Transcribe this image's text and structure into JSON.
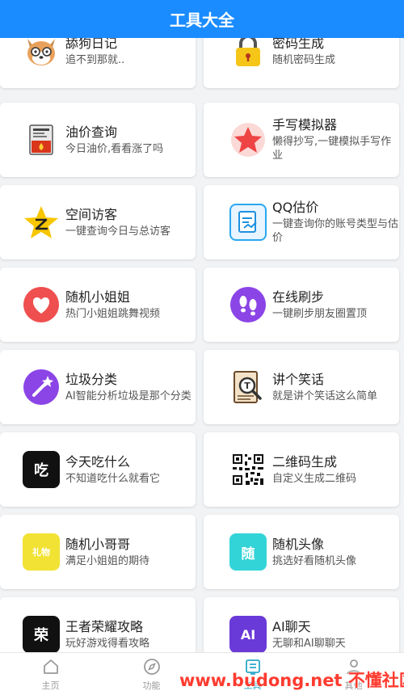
{
  "header": {
    "title": "工具大全"
  },
  "tools": [
    {
      "title": "舔狗日记",
      "desc": "追不到那就..",
      "icon": "dog-face-icon"
    },
    {
      "title": "密码生成",
      "desc": "随机密码生成",
      "icon": "padlock-icon"
    },
    {
      "title": "油价查询",
      "desc": "今日油价,看看涨了吗",
      "icon": "fuel-pump-icon"
    },
    {
      "title": "手写模拟器",
      "desc": "懒得抄写,一键模拟手写作业",
      "icon": "star-badge-icon"
    },
    {
      "title": "空间访客",
      "desc": "一键查询今日与总访客",
      "icon": "qzone-star-icon"
    },
    {
      "title": "QQ估价",
      "desc": "一键查询你的账号类型与估价",
      "icon": "document-chart-icon"
    },
    {
      "title": "随机小姐姐",
      "desc": "热门小姐姐跳舞视频",
      "icon": "heart-icon"
    },
    {
      "title": "在线刷步",
      "desc": "一键刷步朋友圈置顶",
      "icon": "footprints-icon"
    },
    {
      "title": "垃圾分类",
      "desc": "AI智能分析垃圾是那个分类",
      "icon": "magic-wand-icon"
    },
    {
      "title": "讲个笑话",
      "desc": "就是讲个笑话这么简单",
      "icon": "book-search-icon"
    },
    {
      "title": "今天吃什么",
      "desc": "不知道吃什么就看它",
      "icon": "eat-char-icon",
      "glyph": "吃"
    },
    {
      "title": "二维码生成",
      "desc": "自定义生成二维码",
      "icon": "qr-code-icon"
    },
    {
      "title": "随机小哥哥",
      "desc": "满足小姐姐的期待",
      "icon": "gift-tag-icon",
      "glyph": "礼物"
    },
    {
      "title": "随机头像",
      "desc": "挑选好看随机头像",
      "icon": "random-char-icon",
      "glyph": "随"
    },
    {
      "title": "王者荣耀攻略",
      "desc": "玩好游戏得看攻略",
      "icon": "glory-char-icon",
      "glyph": "荣"
    },
    {
      "title": "AI聊天",
      "desc": "无聊和AI聊聊天",
      "icon": "ai-chat-icon",
      "glyph": "AI"
    }
  ],
  "tabbar": {
    "items": [
      {
        "label": "主页",
        "icon": "home-icon"
      },
      {
        "label": "功能",
        "icon": "compass-icon"
      },
      {
        "label": "工具",
        "icon": "toolbox-icon",
        "active": true
      },
      {
        "label": "其他",
        "icon": "user-icon"
      }
    ],
    "active_color": "#2aa7c9"
  },
  "watermark": "www.budong.net 不懂社区",
  "colors": {
    "header": "#1a8cff",
    "background": "#f2f3f5"
  }
}
